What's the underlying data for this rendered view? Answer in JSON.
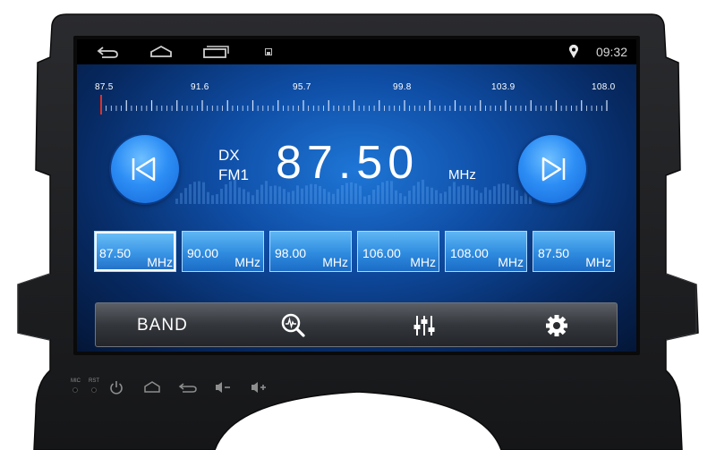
{
  "status_bar": {
    "time": "09:32",
    "nav_icons": [
      "back-icon",
      "home-icon",
      "recent-apps-icon"
    ],
    "notification_icon": "screenshot-icon",
    "location_icon": "location-pin-icon"
  },
  "scale": {
    "labels": [
      "87.5",
      "91.6",
      "95.7",
      "99.8",
      "103.9",
      "108.0"
    ],
    "min": 87.5,
    "max": 108.0,
    "current": 87.5,
    "needle_color": "#e0302a"
  },
  "tuner": {
    "mode": "DX",
    "band": "FM1",
    "frequency": "87.50",
    "unit": "MHz",
    "prev_icon": "seek-previous-icon",
    "next_icon": "seek-next-icon"
  },
  "presets": [
    {
      "freq": "87.50",
      "unit": "MHz",
      "active": true
    },
    {
      "freq": "90.00",
      "unit": "MHz",
      "active": false
    },
    {
      "freq": "98.00",
      "unit": "MHz",
      "active": false
    },
    {
      "freq": "106.00",
      "unit": "MHz",
      "active": false
    },
    {
      "freq": "108.00",
      "unit": "MHz",
      "active": false
    },
    {
      "freq": "87.50",
      "unit": "MHz",
      "active": false
    }
  ],
  "toolbar": {
    "band_label": "BAND",
    "search_icon": "scan-search-icon",
    "eq_icon": "equalizer-icon",
    "settings_icon": "settings-gear-icon"
  },
  "hardware": {
    "mic_label": "MIC",
    "rst_label": "RST",
    "buttons": [
      "power-icon",
      "home-icon",
      "back-icon",
      "volume-down-icon",
      "volume-up-icon"
    ]
  },
  "colors": {
    "accent": "#2f8bdf",
    "screen_bg": "#0f4ea6",
    "bezel": "#1e1f21"
  }
}
